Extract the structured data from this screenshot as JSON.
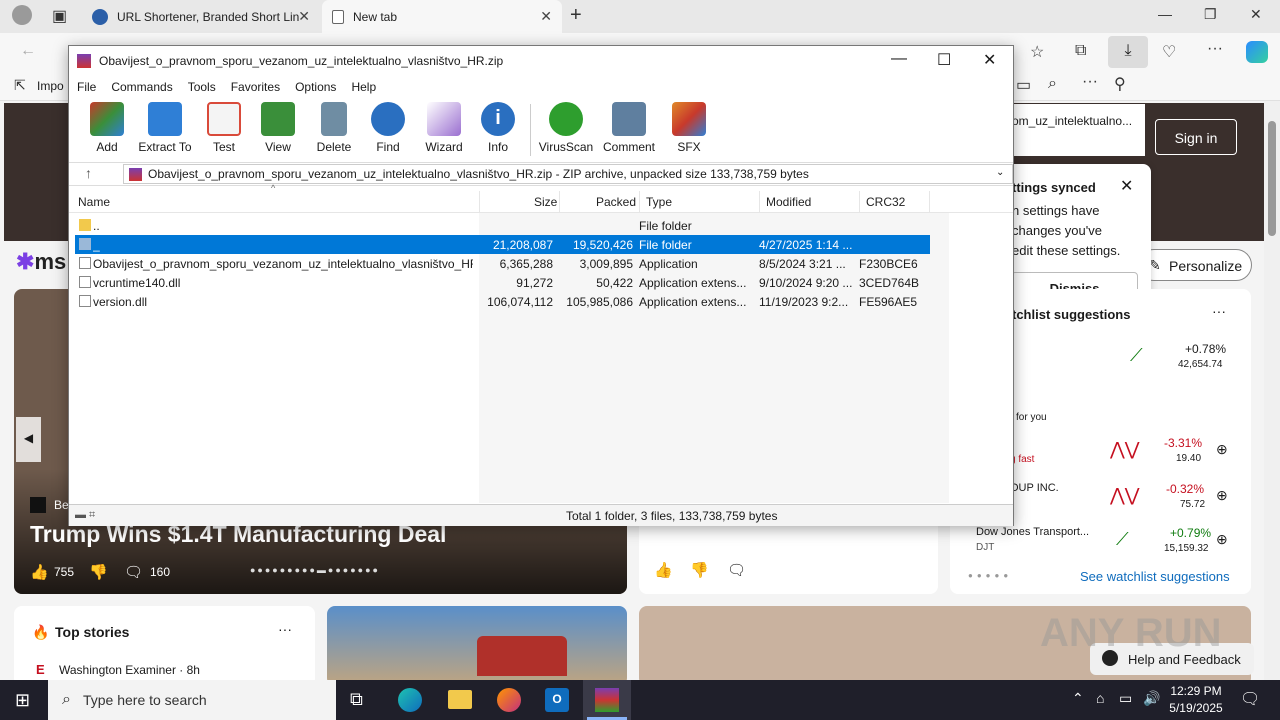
{
  "browser": {
    "tabs": [
      {
        "label": "URL Shortener, Branded Short Lin"
      },
      {
        "label": "New tab"
      }
    ],
    "favorites_bar": {
      "first_item": "Impo"
    },
    "extra_addr_text": "om_uz_intelektualno..."
  },
  "msn": {
    "logo": "ms",
    "sign_in": "Sign in",
    "personalize": "Personalize",
    "settings_popup": {
      "title": "ttings synced",
      "body_lines": [
        "n settings have",
        "changes you've",
        "edit these settings."
      ],
      "dismiss": "Dismiss"
    },
    "hero": {
      "source": "Be",
      "headline": "Trump Wins $1.4T Manufacturing Deal",
      "likes": "755",
      "comments": "160"
    },
    "watchlist": {
      "title": "tchlist suggestions",
      "for_you": "for you",
      "items": [
        {
          "name": "",
          "ticker": "",
          "change": "+0.78%",
          "value": "42,654.74",
          "color": "#107c10"
        },
        {
          "name": "g fast",
          "ticker": "",
          "change": "-3.31%",
          "value": "19.40",
          "color": "#c50f1f"
        },
        {
          "name": "OUP INC.",
          "ticker": "",
          "change": "-0.32%",
          "value": "75.72",
          "color": "#c50f1f"
        },
        {
          "name": "Dow Jones Transport...",
          "ticker": "DJT",
          "change": "+0.79%",
          "value": "15,159.32",
          "color": "#107c10"
        }
      ],
      "see_more": "See watchlist suggestions"
    },
    "top_stories": {
      "title": "Top stories",
      "source": "Washington Examiner · 8h"
    },
    "help_feedback": "Help and Feedback"
  },
  "winrar": {
    "title": "Obavijest_o_pravnom_sporu_vezanom_uz_intelektualno_vlasništvo_HR.zip",
    "menu": [
      "File",
      "Commands",
      "Tools",
      "Favorites",
      "Options",
      "Help"
    ],
    "toolbar": [
      {
        "label": "Add",
        "color": "#c8392b"
      },
      {
        "label": "Extract To",
        "color": "#2f7fd6"
      },
      {
        "label": "Test",
        "color": "#d94a3a"
      },
      {
        "label": "View",
        "color": "#3a8f3a"
      },
      {
        "label": "Delete",
        "color": "#6f8da3"
      },
      {
        "label": "Find",
        "color": "#2a6fc0"
      },
      {
        "label": "Wizard",
        "color": "#9a6fd0"
      },
      {
        "label": "Info",
        "color": "#2a6fc0"
      },
      {
        "label": "VirusScan",
        "color": "#2e9e2e"
      },
      {
        "label": "Comment",
        "color": "#5f7f9f"
      },
      {
        "label": "SFX",
        "color": "#e08a2a"
      }
    ],
    "path": "Obavijest_o_pravnom_sporu_vezanom_uz_intelektualno_vlasništvo_HR.zip - ZIP archive, unpacked size 133,738,759 bytes",
    "columns": [
      "Name",
      "Size",
      "Packed",
      "Type",
      "Modified",
      "CRC32"
    ],
    "files": [
      {
        "name": "..",
        "size": "",
        "packed": "",
        "type": "File folder",
        "modified": "",
        "crc": "",
        "icon": "folder"
      },
      {
        "name": "_",
        "size": "21,208,087",
        "packed": "19,520,426",
        "type": "File folder",
        "modified": "4/27/2025 1:14 ...",
        "crc": "",
        "icon": "folder"
      },
      {
        "name": "Obavijest_o_pravnom_sporu_vezanom_uz_intelektualno_vlasništvo_HR....",
        "size": "6,365,288",
        "packed": "3,009,895",
        "type": "Application",
        "modified": "8/5/2024 3:21 ...",
        "crc": "F230BCE6",
        "icon": "file"
      },
      {
        "name": "vcruntime140.dll",
        "size": "91,272",
        "packed": "50,422",
        "type": "Application extens...",
        "modified": "9/10/2024 9:20 ...",
        "crc": "3CED764B",
        "icon": "file"
      },
      {
        "name": "version.dll",
        "size": "106,074,112",
        "packed": "105,985,086",
        "type": "Application extens...",
        "modified": "11/19/2023 9:2...",
        "crc": "FE596AE5",
        "icon": "file"
      }
    ],
    "status": "Total 1 folder, 3 files, 133,738,759 bytes"
  },
  "taskbar": {
    "search_placeholder": "Type here to search",
    "time": "12:29 PM",
    "date": "5/19/2025"
  },
  "watermark": "ANY RUN"
}
